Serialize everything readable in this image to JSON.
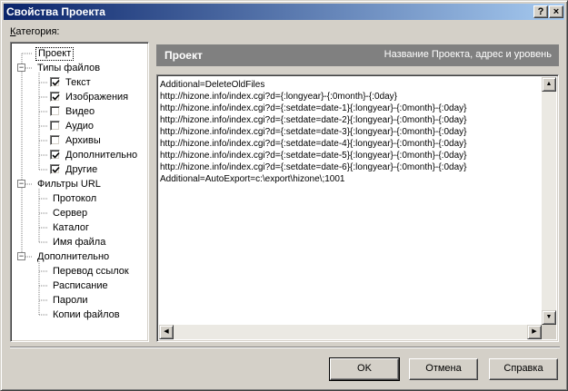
{
  "window": {
    "title": "Свойства Проекта",
    "help_glyph": "?",
    "close_glyph": "×"
  },
  "category_label_prefix": "К",
  "category_label_rest": "атегория:",
  "tree": {
    "nodes": [
      {
        "label": "Проект",
        "level": 0,
        "selected": true
      },
      {
        "label": "Типы файлов",
        "level": 0,
        "expander": "−"
      },
      {
        "label": "Текст",
        "level": 1,
        "checked": true
      },
      {
        "label": "Изображения",
        "level": 1,
        "checked": true
      },
      {
        "label": "Видео",
        "level": 1,
        "checked": false
      },
      {
        "label": "Аудио",
        "level": 1,
        "checked": false
      },
      {
        "label": "Архивы",
        "level": 1,
        "checked": false
      },
      {
        "label": "Дополнительно",
        "level": 1,
        "checked": true
      },
      {
        "label": "Другие",
        "level": 1,
        "checked": true
      },
      {
        "label": "Фильтры URL",
        "level": 0,
        "expander": "−"
      },
      {
        "label": "Протокол",
        "level": 1
      },
      {
        "label": "Сервер",
        "level": 1
      },
      {
        "label": "Каталог",
        "level": 1
      },
      {
        "label": "Имя файла",
        "level": 1
      },
      {
        "label": "Дополнительно",
        "level": 0,
        "expander": "−"
      },
      {
        "label": "Перевод ссылок",
        "level": 1
      },
      {
        "label": "Расписание",
        "level": 1
      },
      {
        "label": "Пароли",
        "level": 1
      },
      {
        "label": "Копии файлов",
        "level": 1
      }
    ]
  },
  "panel": {
    "title": "Проект",
    "subtitle": "Название Проекта, адрес и уровень"
  },
  "memo": {
    "lines": [
      "Additional=DeleteOldFiles",
      "http://hizone.info/index.cgi?d={:longyear}-{:0month}-{:0day}",
      "http://hizone.info/index.cgi?d={:setdate=date-1}{:longyear}-{:0month}-{:0day}",
      "http://hizone.info/index.cgi?d={:setdate=date-2}{:longyear}-{:0month}-{:0day}",
      "http://hizone.info/index.cgi?d={:setdate=date-3}{:longyear}-{:0month}-{:0day}",
      "http://hizone.info/index.cgi?d={:setdate=date-4}{:longyear}-{:0month}-{:0day}",
      "http://hizone.info/index.cgi?d={:setdate=date-5}{:longyear}-{:0month}-{:0day}",
      "http://hizone.info/index.cgi?d={:setdate=date-6}{:longyear}-{:0month}-{:0day}",
      "Additional=AutoExport=c:\\export\\hizone\\;1001"
    ]
  },
  "scroll": {
    "up": "▲",
    "down": "▼",
    "left": "◀",
    "right": "▶"
  },
  "buttons": {
    "ok": "OK",
    "cancel": "Отмена",
    "help": "Справка"
  },
  "colors": {
    "title_start": "#0a246a",
    "title_end": "#a6caf0",
    "header_bg": "#808080",
    "face": "#d4d0c8"
  }
}
